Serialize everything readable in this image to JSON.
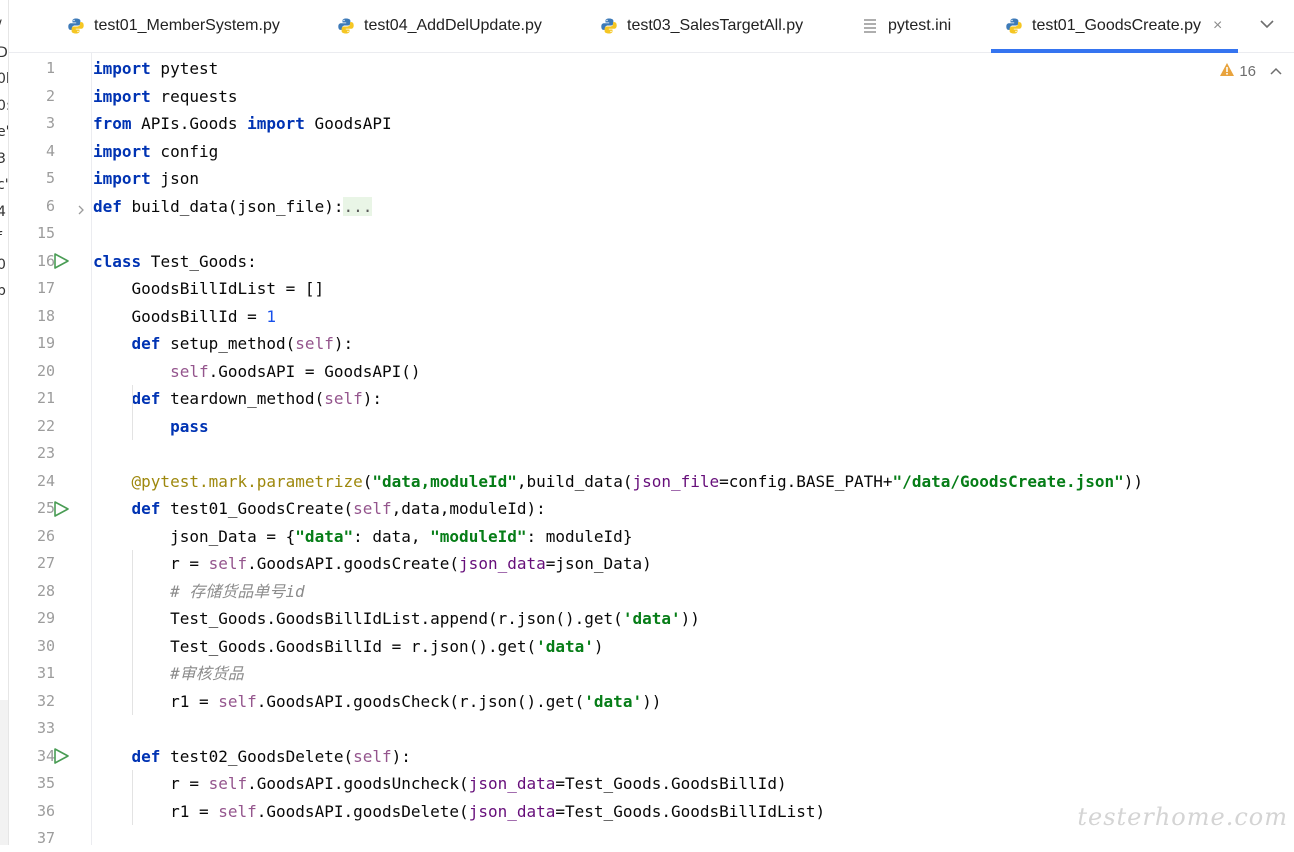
{
  "left_strip": {
    "chars": [
      "/",
      "D:",
      "0l",
      "0:",
      "e'",
      "3",
      "c'",
      "4",
      "f",
      "0",
      "b"
    ]
  },
  "tabs": [
    {
      "label": "test01_MemberSystem.py",
      "icon": "python-file-icon",
      "active": false
    },
    {
      "label": "test04_AddDelUpdate.py",
      "icon": "python-file-icon",
      "active": false
    },
    {
      "label": "test03_SalesTargetAll.py",
      "icon": "python-file-icon",
      "active": false
    },
    {
      "label": "pytest.ini",
      "icon": "text-file-icon",
      "active": false
    },
    {
      "label": "test01_GoodsCreate.py",
      "icon": "python-file-icon",
      "active": true,
      "close": "×"
    }
  ],
  "inspection": {
    "warning_count": "16"
  },
  "lines": [
    {
      "n": "1",
      "text": "import pytest"
    },
    {
      "n": "2",
      "text": "import requests"
    },
    {
      "n": "3",
      "text": "from APIs.Goods import GoodsAPI"
    },
    {
      "n": "4",
      "text": "import config"
    },
    {
      "n": "5",
      "text": "import json"
    },
    {
      "n": "6",
      "text": "def build_data(json_file):...",
      "fold": true
    },
    {
      "n": "15",
      "text": ""
    },
    {
      "n": "16",
      "text": "class Test_Goods:",
      "run": true
    },
    {
      "n": "17",
      "text": "    GoodsBillIdList = []"
    },
    {
      "n": "18",
      "text": "    GoodsBillId = 1"
    },
    {
      "n": "19",
      "text": "    def setup_method(self):"
    },
    {
      "n": "20",
      "text": "        self.GoodsAPI = GoodsAPI()"
    },
    {
      "n": "21",
      "text": "    def teardown_method(self):"
    },
    {
      "n": "22",
      "text": "        pass"
    },
    {
      "n": "23",
      "text": ""
    },
    {
      "n": "24",
      "text": "    @pytest.mark.parametrize(\"data,moduleId\",build_data(json_file=config.BASE_PATH+\"/data/GoodsCreate.json\"))"
    },
    {
      "n": "25",
      "text": "    def test01_GoodsCreate(self,data,moduleId):",
      "run": true
    },
    {
      "n": "26",
      "text": "        json_Data = {\"data\": data, \"moduleId\": moduleId}"
    },
    {
      "n": "27",
      "text": "        r = self.GoodsAPI.goodsCreate(json_data=json_Data)"
    },
    {
      "n": "28",
      "text": "        # 存储货品单号id"
    },
    {
      "n": "29",
      "text": "        Test_Goods.GoodsBillIdList.append(r.json().get('data'))"
    },
    {
      "n": "30",
      "text": "        Test_Goods.GoodsBillId = r.json().get('data')"
    },
    {
      "n": "31",
      "text": "        #审核货品"
    },
    {
      "n": "32",
      "text": "        r1 = self.GoodsAPI.goodsCheck(r.json().get('data'))"
    },
    {
      "n": "33",
      "text": ""
    },
    {
      "n": "34",
      "text": "    def test02_GoodsDelete(self):",
      "run": true
    },
    {
      "n": "35",
      "text": "        r = self.GoodsAPI.goodsUncheck(json_data=Test_Goods.GoodsBillId)"
    },
    {
      "n": "36",
      "text": "        r1 = self.GoodsAPI.goodsDelete(json_data=Test_Goods.GoodsBillIdList)"
    },
    {
      "n": "37",
      "text": ""
    }
  ],
  "watermark": "testerhome.com",
  "colors": {
    "keyword": "#0033b3",
    "self": "#94558d",
    "string": "#067d17",
    "number": "#1750eb",
    "comment": "#8c8c8c",
    "decorator": "#9e880d",
    "param": "#660e7a",
    "active_tab": "#3574f0",
    "run_icon": "#499c54"
  }
}
